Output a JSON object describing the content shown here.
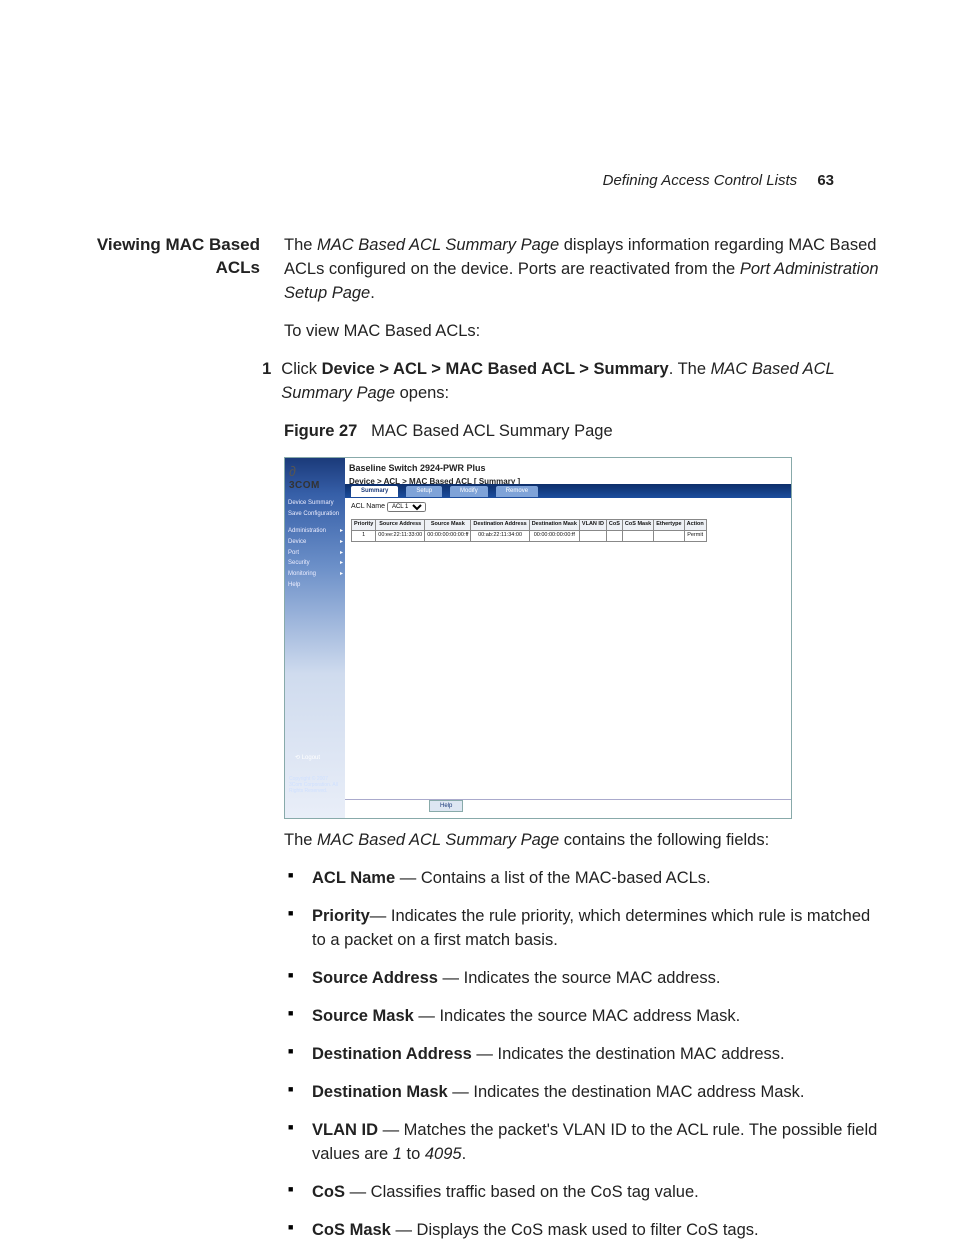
{
  "header": {
    "section": "Defining Access Control Lists",
    "page_number": "63"
  },
  "side_heading": {
    "l1": "Viewing MAC Based",
    "l2": "ACLs"
  },
  "intro": {
    "p1_a": "The ",
    "p1_b": "MAC Based ACL Summary Page",
    "p1_c": " displays information regarding MAC Based ACLs configured on the device. Ports are reactivated from the ",
    "p1_d": "Port Administration Setup Page",
    "p1_e": ".",
    "p2": "To view MAC Based ACLs:"
  },
  "step1": {
    "num": "1",
    "a": "Click ",
    "b": "Device > ACL > MAC Based ACL > Summary",
    "c": ". The ",
    "d": "MAC Based ACL Summary Page",
    "e": " opens:"
  },
  "figure": {
    "label": "Figure 27",
    "caption": "MAC Based ACL Summary Page"
  },
  "shot": {
    "logo": "3COM",
    "title": "Baseline Switch 2924-PWR Plus",
    "breadcrumb": "Device > ACL > MAC Based ACL [ Summary ]",
    "tabs": [
      "Summary",
      "Setup",
      "Modify",
      "Remove"
    ],
    "side_items_top": [
      "Device Summary",
      "Save Configuration"
    ],
    "side_items": [
      "Administration",
      "Device",
      "Port",
      "Security",
      "Monitoring",
      "Help"
    ],
    "logout": "Logout",
    "copyright": "Copyright © 2007 3Com Corporation. All Rights Reserved.",
    "acl_label": "ACL Name",
    "acl_options": [
      "ACL 1"
    ],
    "columns": [
      "Priority",
      "Source Address",
      "Source Mask",
      "Destination Address",
      "Destination Mask",
      "VLAN ID",
      "CoS",
      "CoS Mask",
      "Ethertype",
      "Action"
    ],
    "row": [
      "1",
      "00:ee:22:11:33:00",
      "00:00:00:00:00:ff",
      "00:ab:22:11:34:00",
      "00:00:00:00:00:ff",
      "",
      "",
      "",
      "",
      "Permit"
    ],
    "help_btn": "Help"
  },
  "after_fig": {
    "a": "The ",
    "b": "MAC Based ACL Summary Page",
    "c": " contains the following fields:"
  },
  "fields": [
    {
      "name": "ACL Name",
      "sep": " — ",
      "desc": "Contains a list of the MAC-based ACLs."
    },
    {
      "name": "Priority",
      "sep": "— ",
      "desc": "Indicates the rule priority, which determines which rule is matched to a packet on a first match basis."
    },
    {
      "name": "Source Address",
      "sep": " — ",
      "desc": "Indicates the source MAC address."
    },
    {
      "name": "Source Mask",
      "sep": " — ",
      "desc": "Indicates the source MAC address Mask."
    },
    {
      "name": "Destination Address",
      "sep": " — ",
      "desc": "Indicates the destination MAC address."
    },
    {
      "name": "Destination Mask",
      "sep": " — ",
      "desc": "Indicates the destination MAC address Mask."
    },
    {
      "name": "VLAN ID",
      "sep": " — ",
      "desc_a": "Matches the packet's VLAN ID to the ACL rule. The possible field values are ",
      "v1": "1",
      "mid": " to ",
      "v2": "4095",
      "tail": "."
    },
    {
      "name": "CoS",
      "sep": " — ",
      "desc": "Classifies traffic based on the CoS tag value."
    },
    {
      "name": "CoS Mask",
      "sep": " — ",
      "desc": "Displays the CoS mask used to filter CoS tags."
    }
  ]
}
